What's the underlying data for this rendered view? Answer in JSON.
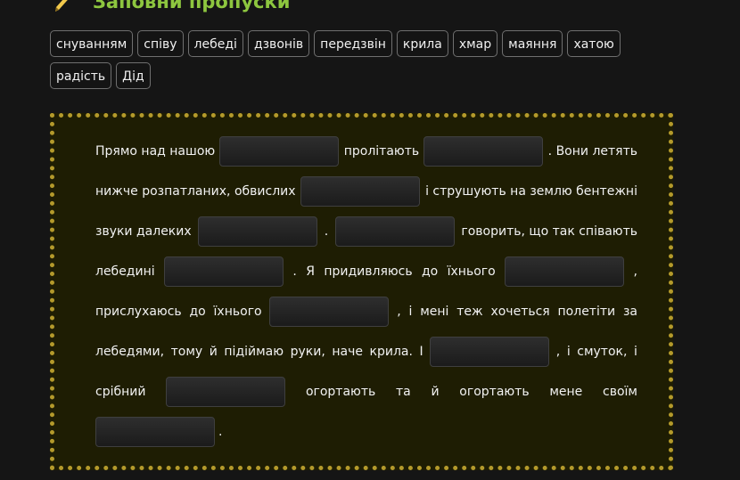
{
  "header": {
    "title": "Заповни пропуски",
    "icon": "pencil-icon"
  },
  "word_bank": {
    "row1": [
      "снуванням",
      "співу",
      "лебеді",
      "дзвонів",
      "передзвін",
      "крила",
      "хмар",
      "маяння",
      "хатою"
    ],
    "row2": [
      "радість",
      "Дід"
    ]
  },
  "text": {
    "l1": {
      "a": "Прямо над нашою",
      "b": "пролітають",
      "c": ". Вони летять"
    },
    "l2": {
      "a": "нижче розпатланих, обвислих",
      "b": "і струшують на землю бентежні"
    },
    "l3": {
      "a": "звуки далеких",
      "b": ".",
      "c": "говорить, що так співають"
    },
    "l4": {
      "a": "лебедині",
      "b": ".",
      "c": "Я",
      "d": "придивляюсь",
      "e": "до",
      "f": "їхнього",
      "g": ","
    },
    "l5": {
      "a": "прислухаюсь",
      "b": "до",
      "c": "їхнього",
      "d": ",",
      "e": "і",
      "f": "мені",
      "g": "теж",
      "h": "хочеться",
      "i": "полетіти",
      "j": "за"
    },
    "l6": {
      "a": "лебедями,",
      "b": "тому",
      "c": "й",
      "d": "підіймаю",
      "e": "руки,",
      "f": "наче",
      "g": "крила.",
      "h": "І",
      "i": ",",
      "j": "і",
      "k": "смуток,",
      "l": "і"
    },
    "l7": {
      "a": "срібний",
      "b": "огортають",
      "c": "та",
      "d": "й",
      "e": "огортають",
      "f": "мене",
      "g": "своїм"
    },
    "l8": {
      "a": "."
    }
  }
}
